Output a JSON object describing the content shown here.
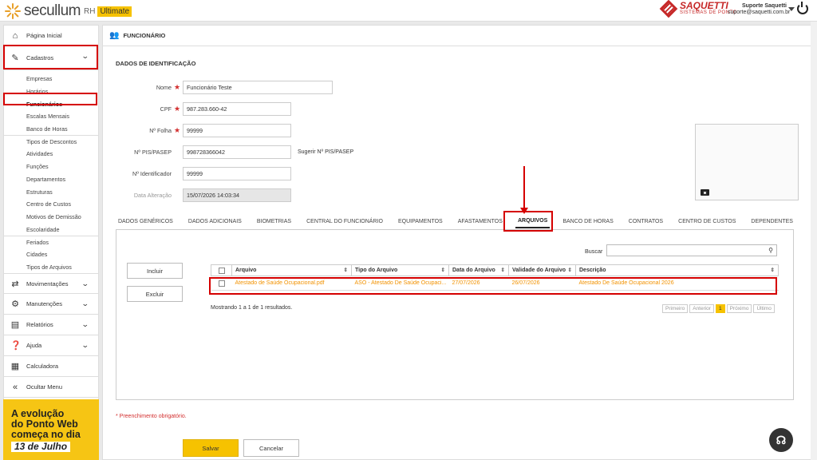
{
  "app": {
    "logo": "secullum",
    "rh": "RH",
    "edition": "Ultimate"
  },
  "brand": {
    "name": "SAQUETTI",
    "sub": "SISTEMAS DE PONTO"
  },
  "user": {
    "name": "Suporte Saquetti",
    "email": "suporte@saquetti.com.br"
  },
  "sidebar": {
    "home": "Página Inicial",
    "cadastros": "Cadastros",
    "cad_items": [
      "Empresas",
      "Horários",
      "Funcionários",
      "Escalas Mensais",
      "Banco de Horas",
      "Tipos de Descontos",
      "Atividades",
      "Funções",
      "Departamentos",
      "Estruturas",
      "Centro de Custos",
      "Motivos de Demissão",
      "Escolaridade",
      "Feriados",
      "Cidades",
      "Tipos de Arquivos"
    ],
    "movimentacoes": "Movimentações",
    "manutencoes": "Manutenções",
    "relatorios": "Relatórios",
    "ajuda": "Ajuda",
    "calculadora": "Calculadora",
    "ocultar": "Ocultar Menu"
  },
  "ad": {
    "line1": "A evolução",
    "line2": "do Ponto Web",
    "line3": "começa no dia",
    "date": "13 de Julho"
  },
  "page": {
    "title": "FUNCIONÁRIO",
    "section": "DADOS DE IDENTIFICAÇÃO"
  },
  "form": {
    "nome_label": "Nome",
    "nome": "Funcionário Teste",
    "cpf_label": "CPF",
    "cpf": "987.283.660-42",
    "folha_label": "Nº Folha",
    "folha": "99999",
    "pis_label": "Nº PIS/PASEP",
    "pis": "998728366042",
    "sugerir": "Sugerir Nº PIS/PASEP",
    "ident_label": "Nº Identificador",
    "ident": "99999",
    "alter_label": "Data Alteração",
    "alter": "15/07/2026 14:03:34"
  },
  "tabs": [
    "DADOS GENÉRICOS",
    "DADOS ADICIONAIS",
    "BIOMETRIAS",
    "CENTRAL DO FUNCIONÁRIO",
    "EQUIPAMENTOS",
    "AFASTAMENTOS",
    "ARQUIVOS",
    "BANCO DE HORAS",
    "CONTRATOS",
    "CENTRO DE CUSTOS",
    "DEPENDENTES"
  ],
  "arquivos": {
    "incluir": "Incluir",
    "excluir": "Excluir",
    "buscar": "Buscar",
    "headers": [
      "Arquivo",
      "Tipo do Arquivo",
      "Data do Arquivo",
      "Validade do Arquivo",
      "Descrição"
    ],
    "row": [
      "Atestado de Saúde Ocupacional.pdf",
      "ASO - Atestado De Saúde Ocupaci...",
      "27/07/2026",
      "26/07/2026",
      "Atestado De Saúde Ocupacional 2026"
    ],
    "count": "Mostrando 1 a 1 de 1 resultados.",
    "pager": [
      "Primeiro",
      "Anterior",
      "1",
      "Próximo",
      "Último"
    ]
  },
  "footer": {
    "req": "* Preenchimento obrigatório.",
    "save": "Salvar",
    "cancel": "Cancelar"
  }
}
